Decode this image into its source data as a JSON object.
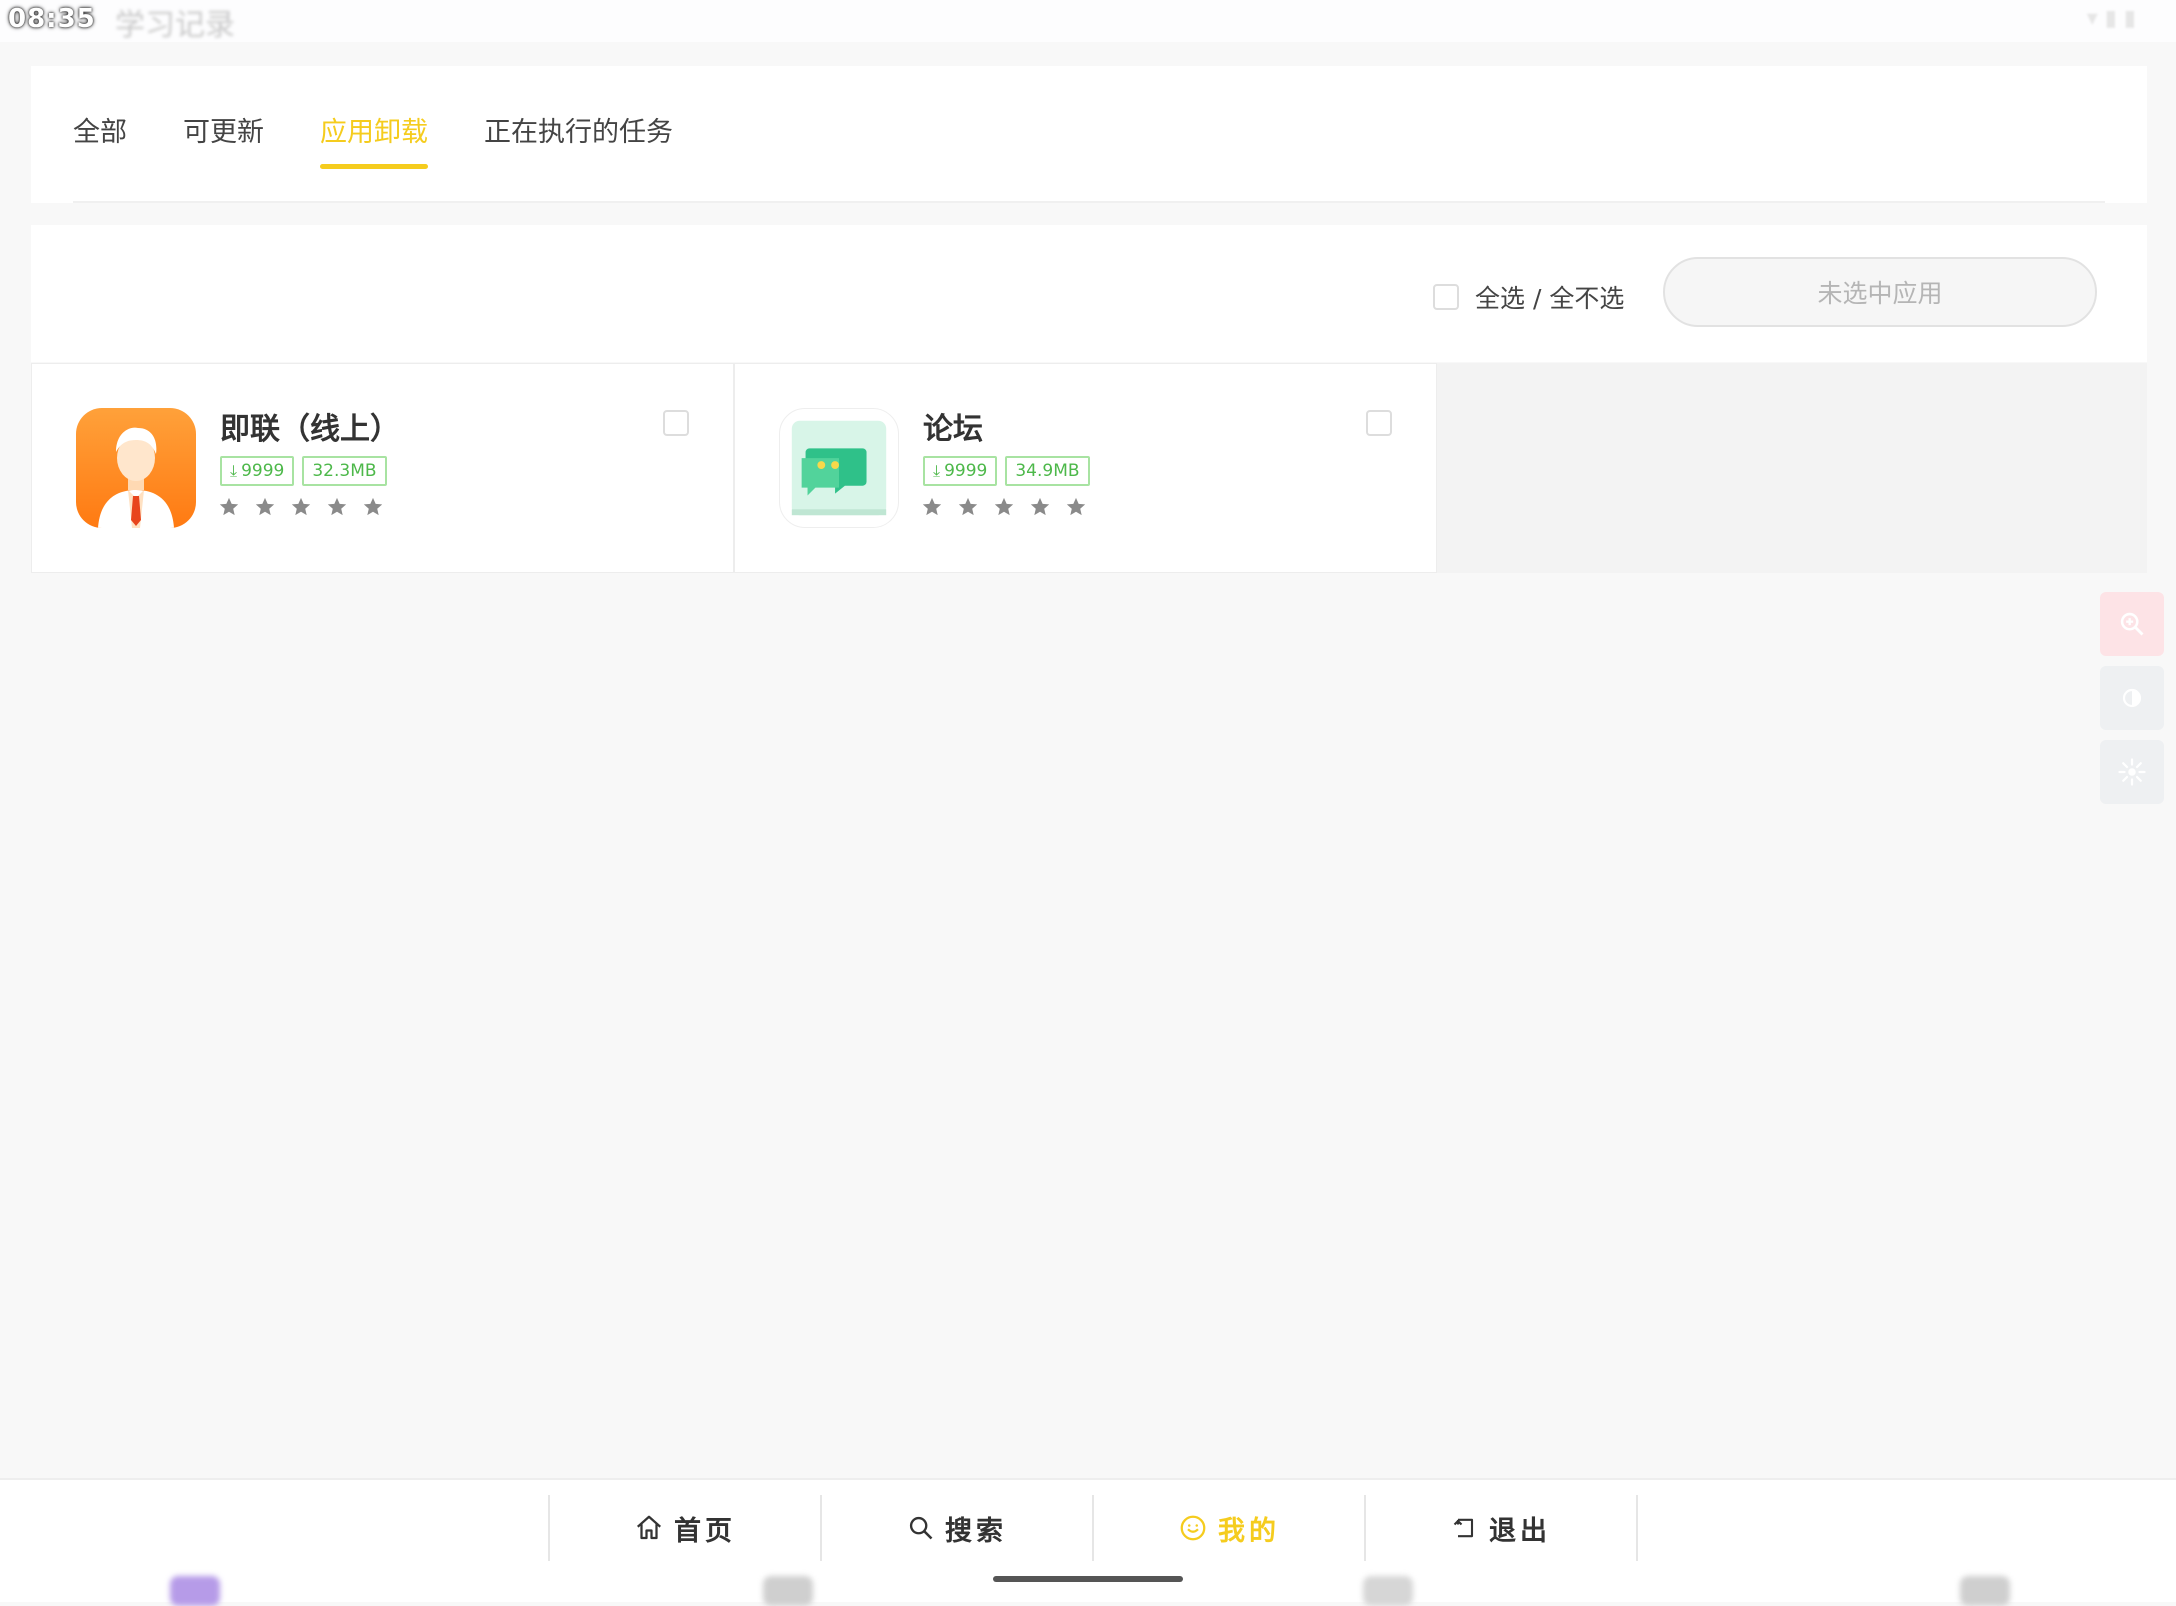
{
  "status_bar": {
    "time": "08:35",
    "title": "学习记录"
  },
  "tabs": [
    {
      "label": "全部",
      "active": false
    },
    {
      "label": "可更新",
      "active": false
    },
    {
      "label": "应用卸载",
      "active": true
    },
    {
      "label": "正在执行的任务",
      "active": false
    }
  ],
  "toolbar": {
    "select_all_label": "全选 / 全不选",
    "uninstall_button_label": "未选中应用"
  },
  "apps": [
    {
      "name": "即联（线上）",
      "downloads": "9999",
      "size": "32.3MB",
      "rating": 0,
      "icon": "person-suit-icon"
    },
    {
      "name": "论坛",
      "downloads": "9999",
      "size": "34.9MB",
      "rating": 0,
      "icon": "chat-bubble-icon"
    }
  ],
  "bottom_nav": [
    {
      "label": "首页",
      "icon": "home-icon",
      "active": false
    },
    {
      "label": "搜索",
      "icon": "search-icon",
      "active": false
    },
    {
      "label": "我的",
      "icon": "smile-icon",
      "active": true
    },
    {
      "label": "退出",
      "icon": "exit-icon",
      "active": false
    }
  ],
  "colors": {
    "accent": "#f5cc1e",
    "tag_green": "#4db84a",
    "star_gray": "#8a8a8a"
  }
}
